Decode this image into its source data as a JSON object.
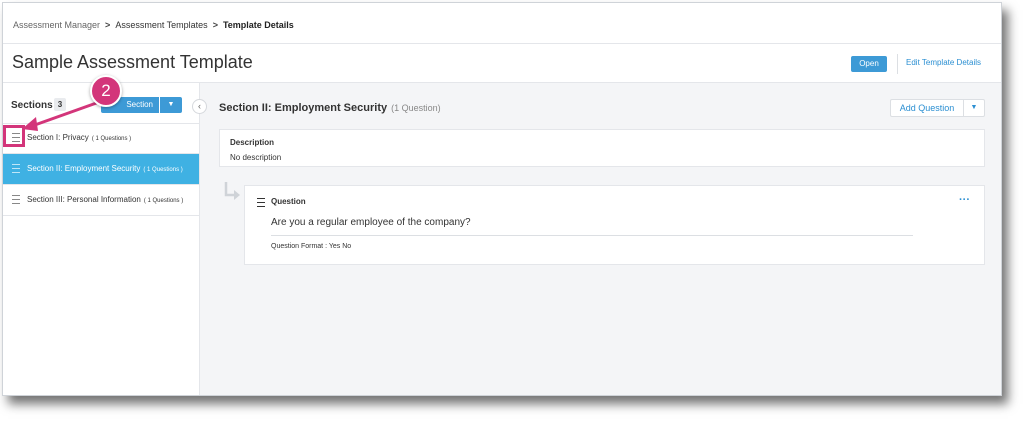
{
  "breadcrumb": {
    "item1": "Assessment Manager",
    "item2": "Assessment Templates",
    "item3": "Template Details",
    "separator": ">"
  },
  "header": {
    "title": "Sample Assessment Template",
    "open_label": "Open",
    "edit_label": "Edit Template Details"
  },
  "sidebar": {
    "sections_label": "Sections",
    "sections_count": "3",
    "add_section_label": "Section",
    "items": [
      {
        "name": "Section I: Privacy",
        "count": "( 1 Questions )"
      },
      {
        "name": "Section II: Employment Security",
        "count": "( 1 Questions )"
      },
      {
        "name": "Section III: Personal Information",
        "count": "( 1 Questions )"
      }
    ]
  },
  "main": {
    "section_title": "Section II: Employment Security",
    "question_count": "(1 Question)",
    "add_question_label": "Add Question",
    "description_label": "Description",
    "description_text": "No description",
    "question": {
      "label": "Question",
      "text": "Are you a regular employee of the company?",
      "format": "Question Format : Yes No",
      "more": "···"
    }
  },
  "annotation": {
    "step_number": "2",
    "color": "#d3357a"
  },
  "colors": {
    "accent": "#3d9ad6",
    "active_item": "#3fb1e3",
    "link": "#2b8fd2"
  }
}
